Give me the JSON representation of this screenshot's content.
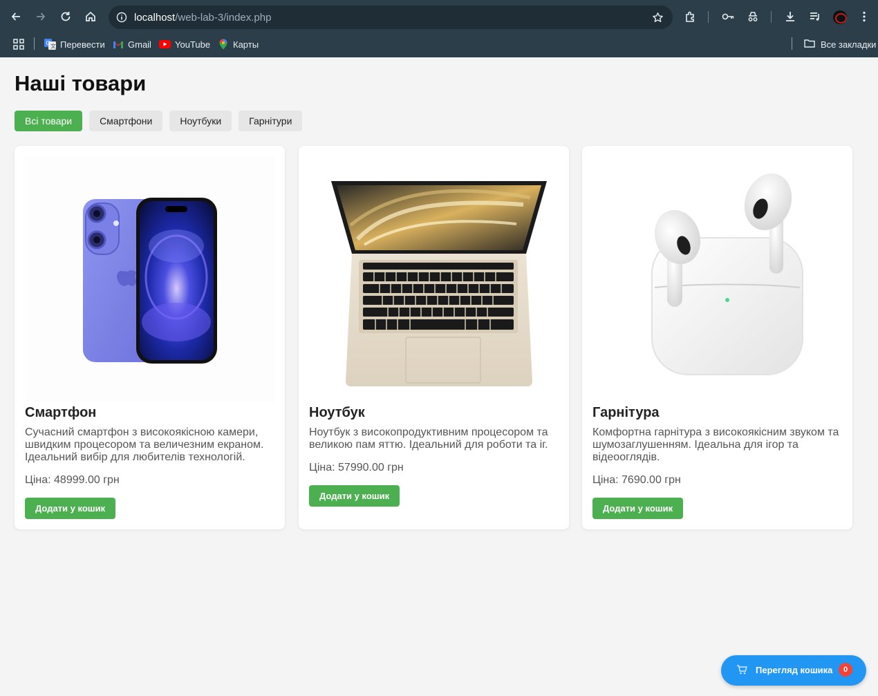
{
  "browser": {
    "url_host": "localhost",
    "url_path": "/web-lab-3/index.php",
    "bookmarks": [
      {
        "label": "Перевести",
        "icon": "google-translate-icon"
      },
      {
        "label": "Gmail",
        "icon": "gmail-icon"
      },
      {
        "label": "YouTube",
        "icon": "youtube-icon"
      },
      {
        "label": "Карты",
        "icon": "maps-icon"
      }
    ],
    "all_bookmarks_label": "Все закладки"
  },
  "page": {
    "title": "Наші товари",
    "filters": [
      {
        "label": "Всі товари",
        "active": true
      },
      {
        "label": "Смартфони",
        "active": false
      },
      {
        "label": "Ноутбуки",
        "active": false
      },
      {
        "label": "Гарнітури",
        "active": false
      }
    ],
    "products": [
      {
        "title": "Смартфон",
        "description": "Сучасний смартфон з високоякісною камери, швидким процесором та величезним екраном. Ідеальний вибір для любителів технологій.",
        "price": "Ціна: 48999.00 грн",
        "button": "Додати у кошик",
        "image_icon": "smartphone-image"
      },
      {
        "title": "Ноутбук",
        "description": "Ноутбук з високопродуктивним процесором та великою пам яттю. Ідеальний для роботи та іг.",
        "price": "Ціна: 57990.00 грн",
        "button": "Додати у кошик",
        "image_icon": "laptop-image"
      },
      {
        "title": "Гарнітура",
        "description": "Комфортна гарнітура з високоякісним звуком та шумозаглушенням. Ідеальна для ігор та відеооглядів.",
        "price": "Ціна: 7690.00 грн",
        "button": "Додати у кошик",
        "image_icon": "earbuds-image"
      }
    ],
    "cart": {
      "label": "Перегляд кошика",
      "count": "0",
      "icon": "cart-icon"
    }
  },
  "colors": {
    "accent_green": "#4caf50",
    "cart_blue": "#2196f3",
    "badge_red": "#f44336"
  }
}
